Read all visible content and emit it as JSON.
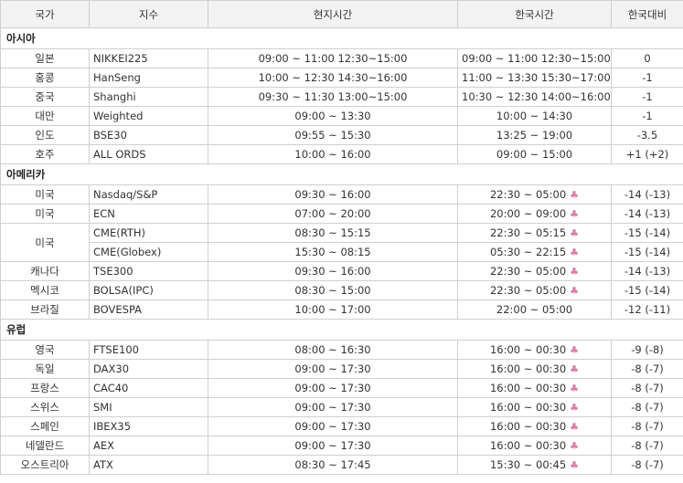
{
  "header": {
    "country": "국가",
    "index": "지수",
    "local_time": "현지시간",
    "korea_time": "한국시간",
    "diff": "한국대비"
  },
  "dst_mark_color": "#d97aa5",
  "regions": [
    {
      "name": "아시아",
      "rows": [
        {
          "country": "일본",
          "index": "NIKKEI225",
          "local": "09:00 ~ 11:00 12:30~15:00",
          "korea": "09:00 ~ 11:00 12:30~15:00",
          "dst": false,
          "diff": "0"
        },
        {
          "country": "홍콩",
          "index": "HanSeng",
          "local": "10:00 ~ 12:30 14:30~16:00",
          "korea": "11:00 ~ 13:30 15:30~17:00",
          "dst": false,
          "diff": "-1"
        },
        {
          "country": "중국",
          "index": "Shanghi",
          "local": "09:30 ~ 11:30 13:00~15:00",
          "korea": "10:30 ~ 12:30 14:00~16:00",
          "dst": false,
          "diff": "-1"
        },
        {
          "country": "대만",
          "index": "Weighted",
          "local": "09:00 ~ 13:30",
          "korea": "10:00 ~ 14:30",
          "dst": false,
          "diff": "-1"
        },
        {
          "country": "인도",
          "index": "BSE30",
          "local": "09:55 ~ 15:30",
          "korea": "13:25 ~ 19:00",
          "dst": false,
          "diff": "-3.5"
        },
        {
          "country": "호주",
          "index": "ALL ORDS",
          "local": "10:00 ~ 16:00",
          "korea": "09:00 ~ 15:00",
          "dst": false,
          "diff": "+1 (+2)"
        }
      ]
    },
    {
      "name": "아메리카",
      "rows": [
        {
          "country": "미국",
          "index": "Nasdaq/S&P",
          "local": "09:30 ~ 16:00",
          "korea": "22:30 ~ 05:00",
          "dst": true,
          "diff": "-14 (-13)"
        },
        {
          "country": "미국",
          "index": "ECN",
          "local": "07:00 ~ 20:00",
          "korea": "20:00 ~ 09:00",
          "dst": true,
          "diff": "-14 (-13)"
        },
        {
          "country": "미국",
          "index": "CME(RTH)",
          "local": "08:30 ~ 15:15",
          "korea": "22:30 ~ 05:15",
          "dst": true,
          "diff": "-15 (-14)",
          "rowspan": 2
        },
        {
          "country": "",
          "index": "CME(Globex)",
          "local": "15:30 ~ 08:15",
          "korea": "05:30 ~ 22:15",
          "dst": true,
          "diff": "-15 (-14)",
          "merged": true
        },
        {
          "country": "캐나다",
          "index": "TSE300",
          "local": "09:30 ~ 16:00",
          "korea": "22:30 ~ 05:00",
          "dst": true,
          "diff": "-14 (-13)"
        },
        {
          "country": "멕시코",
          "index": "BOLSA(IPC)",
          "local": "08:30 ~ 15:00",
          "korea": "22:30 ~ 05:00",
          "dst": true,
          "diff": "-15 (-14)"
        },
        {
          "country": "브라질",
          "index": "BOVESPA",
          "local": "10:00 ~ 17:00",
          "korea": "22:00 ~ 05:00",
          "dst": false,
          "diff": "-12 (-11)"
        }
      ]
    },
    {
      "name": "유럽",
      "rows": [
        {
          "country": "영국",
          "index": "FTSE100",
          "local": "08:00 ~ 16:30",
          "korea": "16:00 ~ 00:30",
          "dst": true,
          "diff": "-9 (-8)"
        },
        {
          "country": "독일",
          "index": "DAX30",
          "local": "09:00 ~ 17:30",
          "korea": "16:00 ~ 00:30",
          "dst": true,
          "diff": "-8 (-7)"
        },
        {
          "country": "프랑스",
          "index": "CAC40",
          "local": "09:00 ~ 17:30",
          "korea": "16:00 ~ 00:30",
          "dst": true,
          "diff": "-8 (-7)"
        },
        {
          "country": "스위스",
          "index": "SMI",
          "local": "09:00 ~ 17:30",
          "korea": "16:00 ~ 00:30",
          "dst": true,
          "diff": "-8 (-7)"
        },
        {
          "country": "스페인",
          "index": "IBEX35",
          "local": "09:00 ~ 17:30",
          "korea": "16:00 ~ 00:30",
          "dst": true,
          "diff": "-8 (-7)"
        },
        {
          "country": "네델란드",
          "index": "AEX",
          "local": "09:00 ~ 17:30",
          "korea": "16:00 ~ 00:30",
          "dst": true,
          "diff": "-8 (-7)"
        },
        {
          "country": "오스트리아",
          "index": "ATX",
          "local": "08:30 ~ 17:45",
          "korea": "15:30 ~ 00:45",
          "dst": true,
          "diff": "-8 (-7)"
        }
      ]
    }
  ]
}
